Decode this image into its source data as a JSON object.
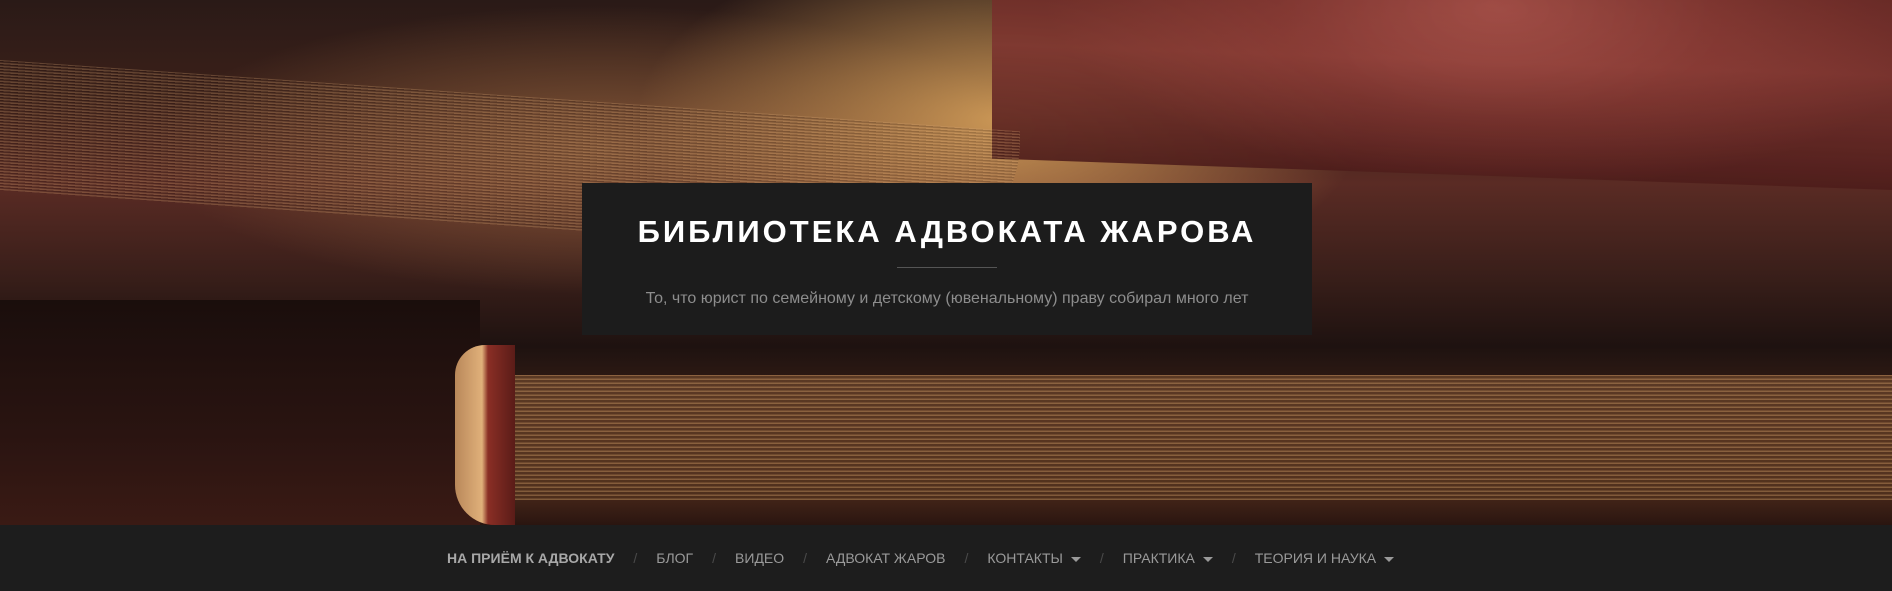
{
  "header": {
    "title": "БИБЛИОТЕКА АДВОКАТА ЖАРОВА",
    "tagline": "То, что юрист по семейному и детскому (ювенальному) праву собирал много лет"
  },
  "nav": {
    "separator": "/",
    "items": [
      {
        "label": "НА ПРИЁМ К АДВОКАТУ",
        "active": true,
        "dropdown": false
      },
      {
        "label": "БЛОГ",
        "active": false,
        "dropdown": false
      },
      {
        "label": "ВИДЕО",
        "active": false,
        "dropdown": false
      },
      {
        "label": "АДВОКАТ ЖАРОВ",
        "active": false,
        "dropdown": false
      },
      {
        "label": "КОНТАКТЫ",
        "active": false,
        "dropdown": true
      },
      {
        "label": "ПРАКТИКА",
        "active": false,
        "dropdown": true
      },
      {
        "label": "ТЕОРИЯ И НАУКА",
        "active": false,
        "dropdown": true
      }
    ]
  },
  "colors": {
    "nav_background": "#1d1d1d",
    "title_box_background": "#1c1c1c",
    "title_text": "#ffffff",
    "tagline_text": "#8d8d8d",
    "nav_text": "#9a9a9a"
  }
}
